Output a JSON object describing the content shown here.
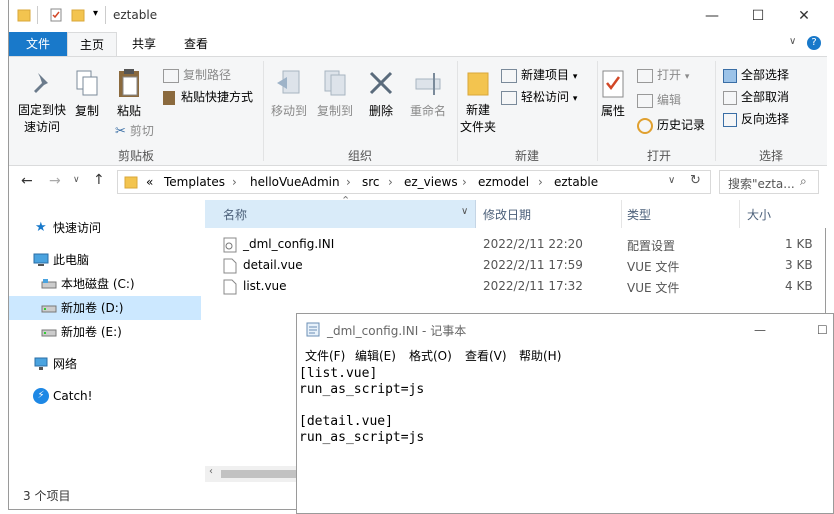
{
  "explorer": {
    "title": "eztable",
    "tabs": {
      "file": "文件",
      "home": "主页",
      "share": "共享",
      "view": "查看"
    },
    "ribbon": {
      "pin": "固定到快\n速访问",
      "copy": "复制",
      "paste": "粘贴",
      "copy_path": "复制路径",
      "paste_shortcut": "粘贴快捷方式",
      "cut": "剪切",
      "clipboard_group": "剪贴板",
      "move_to": "移动到",
      "copy_to": "复制到",
      "delete": "删除",
      "rename": "重命名",
      "organize_group": "组织",
      "new_folder": "新建\n文件夹",
      "new_item": "新建项目",
      "easy_access": "轻松访问",
      "new_group": "新建",
      "properties": "属性",
      "open": "打开",
      "edit": "编辑",
      "history": "历史记录",
      "open_group": "打开",
      "select_all": "全部选择",
      "select_none": "全部取消",
      "invert_selection": "反向选择",
      "select_group": "选择"
    },
    "address": {
      "crumbs": [
        "«",
        "Templates",
        "helloVueAdmin",
        "src",
        "ez_views",
        "ezmodel",
        "eztable"
      ],
      "search_placeholder": "搜索\"ezta..."
    },
    "nav": {
      "quick_access": "快速访问",
      "this_pc": "此电脑",
      "local_c": "本地磁盘 (C:)",
      "new_d": "新加卷 (D:)",
      "new_e": "新加卷 (E:)",
      "network": "网络",
      "catch": "Catch!"
    },
    "columns": {
      "name": "名称",
      "modified": "修改日期",
      "type": "类型",
      "size": "大小"
    },
    "files": [
      {
        "name": "_dml_config.INI",
        "modified": "2022/2/11 22:20",
        "type": "配置设置",
        "size": "1 KB"
      },
      {
        "name": "detail.vue",
        "modified": "2022/2/11 17:59",
        "type": "VUE 文件",
        "size": "3 KB"
      },
      {
        "name": "list.vue",
        "modified": "2022/2/11 17:32",
        "type": "VUE 文件",
        "size": "4 KB"
      }
    ],
    "status": "3 个项目"
  },
  "notepad": {
    "title": "_dml_config.INI - 记事本",
    "menu": {
      "file": "文件(F)",
      "edit": "编辑(E)",
      "format": "格式(O)",
      "view": "查看(V)",
      "help": "帮助(H)"
    },
    "content": "[list.vue]\nrun_as_script=js\n\n[detail.vue]\nrun_as_script=js"
  },
  "colors": {
    "accent": "#1979ca",
    "folder": "#f3c44f",
    "selected": "#cce8ff"
  }
}
